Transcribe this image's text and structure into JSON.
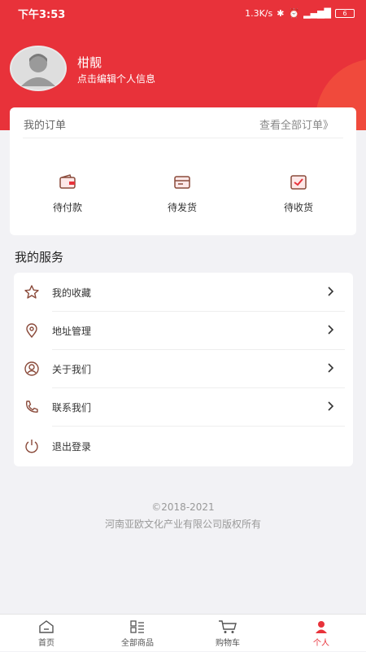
{
  "status_bar": {
    "time": "下午3:53",
    "network_speed": "1.3K/s",
    "battery": "6"
  },
  "profile": {
    "name": "柑靓",
    "subtitle": "点击编辑个人信息"
  },
  "orders": {
    "title": "我的订单",
    "view_all": "查看全部订单》",
    "items": [
      {
        "label": "待付款",
        "icon": "wallet-icon"
      },
      {
        "label": "待发货",
        "icon": "package-icon"
      },
      {
        "label": "待收货",
        "icon": "delivery-check-icon"
      }
    ]
  },
  "services": {
    "title": "我的服务",
    "items": [
      {
        "label": "我的收藏",
        "icon": "star-icon"
      },
      {
        "label": "地址管理",
        "icon": "location-pin-icon"
      },
      {
        "label": "关于我们",
        "icon": "user-circle-icon"
      },
      {
        "label": "联系我们",
        "icon": "phone-icon"
      },
      {
        "label": "退出登录",
        "icon": "power-icon"
      }
    ]
  },
  "footer": {
    "copyright": "©2018-2021",
    "company": "河南亚欧文化产业有限公司版权所有"
  },
  "tabbar": {
    "items": [
      {
        "label": "首页",
        "icon": "home-icon"
      },
      {
        "label": "全部商品",
        "icon": "grid-list-icon"
      },
      {
        "label": "购物车",
        "icon": "cart-icon"
      },
      {
        "label": "个人",
        "icon": "person-icon"
      }
    ]
  },
  "colors": {
    "accent": "#e8323a",
    "icon_brown": "#8a4a3a"
  }
}
